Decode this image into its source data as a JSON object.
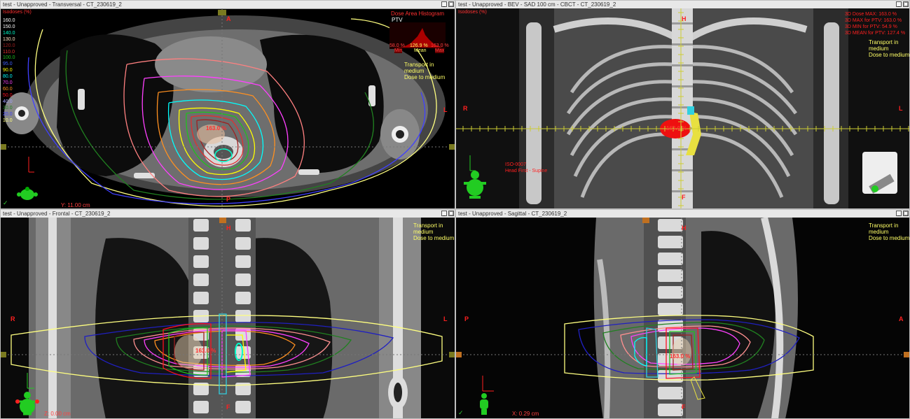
{
  "panes": {
    "transversal": {
      "title": "test - Unapproved - Transversal - CT_230619_2"
    },
    "bev": {
      "title": "test - Unapproved - BEV - SAD 100 cm - CBCT - CT_230619_2"
    },
    "frontal": {
      "title": "test - Unapproved - Frontal - CT_230619_2"
    },
    "sagittal": {
      "title": "test - Unapproved - Sagittal - CT_230619_2"
    }
  },
  "window_buttons": {
    "minimize": "_",
    "maximize": "□"
  },
  "isodose": {
    "header": "Isodoses (%)",
    "levels": [
      {
        "label": "160.0",
        "color": "#ffffff"
      },
      {
        "label": "150.0",
        "color": "#ffffff"
      },
      {
        "label": "140.0",
        "color": "#00ffcc"
      },
      {
        "label": "130.0",
        "color": "#ffe0c0"
      },
      {
        "label": "120.0",
        "color": "#a02020"
      },
      {
        "label": "110.0",
        "color": "#e03030"
      },
      {
        "label": "100.0",
        "color": "#20c020"
      },
      {
        "label": "95.0",
        "color": "#4060ff"
      },
      {
        "label": "90.0",
        "color": "#ffff00"
      },
      {
        "label": "80.0",
        "color": "#00ffff"
      },
      {
        "label": "70.0",
        "color": "#ff40ff"
      },
      {
        "label": "60.0",
        "color": "#ff9020"
      },
      {
        "label": "50.0",
        "color": "#ff1020"
      },
      {
        "label": "40.0",
        "color": "#a0a0ff"
      },
      {
        "label": "30.0",
        "color": "#208020"
      },
      {
        "label": "20.0",
        "color": "#4040ff"
      },
      {
        "label": "10.0",
        "color": "#ffff80"
      }
    ]
  },
  "dvh": {
    "title": "Dose Area Histogram",
    "structure": "PTV",
    "min_value": "58.0 %",
    "mean_value": "126.9 %",
    "max_value": "163.0 %",
    "min_label": "Min",
    "mean_label": "Mean",
    "max_label": "Max"
  },
  "transport": {
    "line1": "Transport in",
    "line2": "medium",
    "line3": "Dose to medium"
  },
  "bev_stats": {
    "dose_max": "3D Dose MAX: 163.0 %",
    "max_ptv": "3D MAX for PTV: 163.0 %",
    "min_ptv": "3D MIN for PTV: 54.9 %",
    "mean_ptv": "3D MEAN for PTV: 127.4 %"
  },
  "bev_iso_label": {
    "line1": "ISO-0007",
    "line2": "Head First - Supine"
  },
  "hotspot": "163.0 %",
  "orientation": {
    "A": "A",
    "P": "P",
    "R": "R",
    "L": "L",
    "H": "H",
    "F": "F"
  },
  "coords": {
    "transversal": "Y: 11.00 cm",
    "frontal": "Z: 0.00 cm",
    "sagittal": "X: 0.29 cm"
  },
  "check_mark": "✓",
  "colors": {
    "accent": "#ff2020",
    "transport": "#ffff66",
    "titlebar": "#e8e8e8",
    "figure": "#22cc22"
  }
}
